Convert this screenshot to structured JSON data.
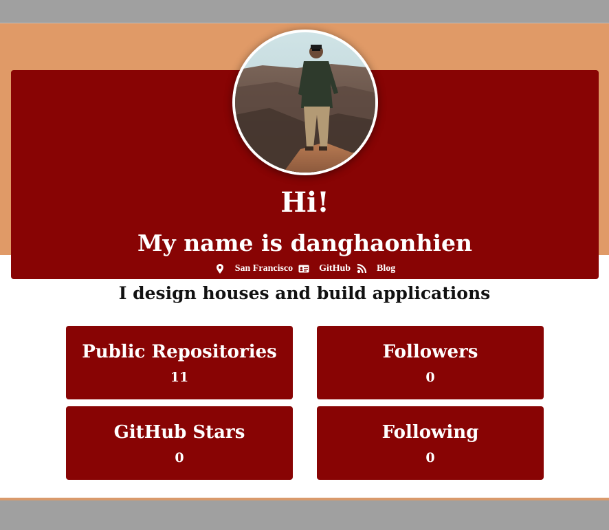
{
  "hero": {
    "greeting": "Hi!",
    "name_line": "My name is danghaonhien",
    "location": "San Francisco",
    "github_label": "GitHub",
    "blog_label": "Blog",
    "avatar_icon": "profile-photo"
  },
  "tagline": "I design houses and build applications",
  "stats": [
    {
      "label": "Public Repositories",
      "value": "11"
    },
    {
      "label": "Followers",
      "value": "0"
    },
    {
      "label": "GitHub Stars",
      "value": "0"
    },
    {
      "label": "Following",
      "value": "0"
    }
  ],
  "colors": {
    "accent": "#880404",
    "band": "#e09a67",
    "frame": "#a0a0a0"
  }
}
